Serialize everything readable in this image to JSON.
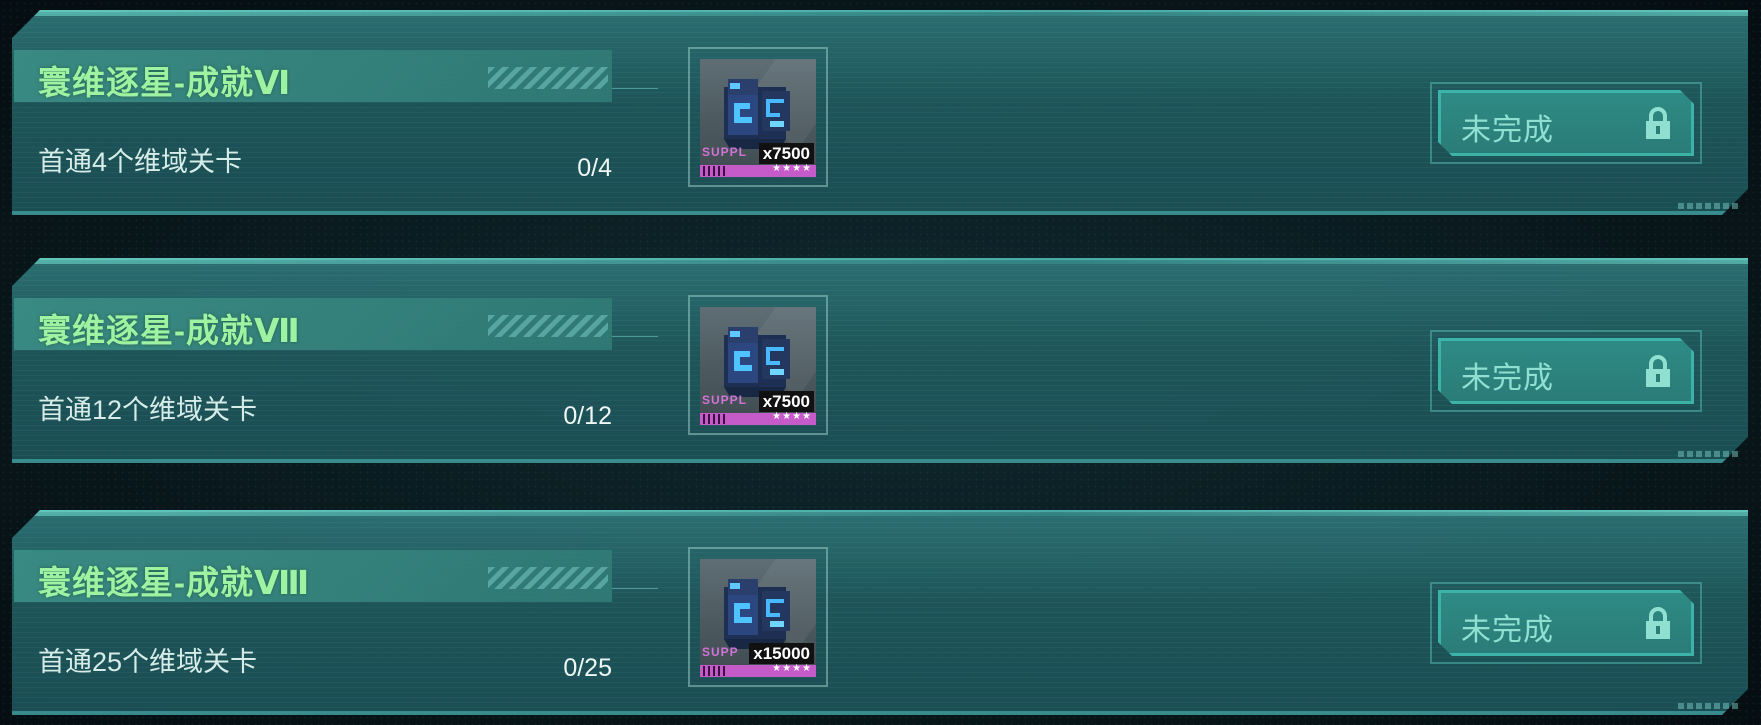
{
  "achievements": [
    {
      "title": "寰维逐星-成就Ⅵ",
      "description": "首通4个维域关卡",
      "progress": "0/4",
      "reward": {
        "icon": "supply-crate-icon",
        "tag": "SUPPL",
        "quantity": "x7500",
        "stars": "★★★★"
      },
      "status": {
        "label": "未完成",
        "icon": "lock-icon"
      }
    },
    {
      "title": "寰维逐星-成就Ⅶ",
      "description": "首通12个维域关卡",
      "progress": "0/12",
      "reward": {
        "icon": "supply-crate-icon",
        "tag": "SUPPL",
        "quantity": "x7500",
        "stars": "★★★★"
      },
      "status": {
        "label": "未完成",
        "icon": "lock-icon"
      }
    },
    {
      "title": "寰维逐星-成就Ⅷ",
      "description": "首通25个维域关卡",
      "progress": "0/25",
      "reward": {
        "icon": "supply-crate-icon",
        "tag": "SUPP",
        "quantity": "x15000",
        "stars": "★★★★"
      },
      "status": {
        "label": "未完成",
        "icon": "lock-icon"
      }
    }
  ],
  "colors": {
    "title": "#9df3a2",
    "panel": "#1f5c60",
    "status_button": "#2f8a85",
    "rarity": "#c45bc9"
  }
}
